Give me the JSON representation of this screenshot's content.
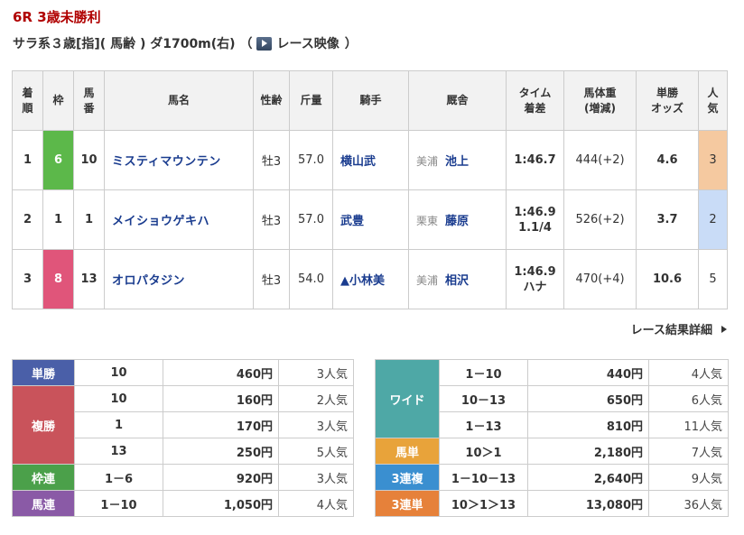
{
  "header": {
    "race_title": "6R 3歳未勝利",
    "race_info": "サラ系３歳[指]( 馬齢 ) ダ1700m(右) （",
    "video_link": "レース映像",
    "race_info_close": "）"
  },
  "results_table": {
    "headers": [
      [
        "着",
        "順"
      ],
      [
        "枠"
      ],
      [
        "馬",
        "番"
      ],
      [
        "馬名"
      ],
      [
        "性齢"
      ],
      [
        "斤量"
      ],
      [
        "騎手"
      ],
      [
        "厩舎"
      ],
      [
        "タイム",
        "着差"
      ],
      [
        "馬体重",
        "(増減)"
      ],
      [
        "単勝",
        "オッズ"
      ],
      [
        "人",
        "気"
      ]
    ],
    "rows": [
      {
        "rank": "1",
        "frame": "6",
        "frame_color": "#5cb84a",
        "number": "10",
        "horse": "ミスティマウンテン",
        "sex_age": "牡3",
        "weight": "57.0",
        "jockey": "横山武",
        "trainer_area": "美浦",
        "trainer": "池上",
        "time": "1:46.7",
        "margin": "",
        "body_weight": "444(+2)",
        "odds": "4.6",
        "popularity": "3",
        "pop_color": "#f5c9a0"
      },
      {
        "rank": "2",
        "frame": "1",
        "frame_color": "#ffffff",
        "number": "1",
        "horse": "メイショウゲキハ",
        "sex_age": "牡3",
        "weight": "57.0",
        "jockey": "武豊",
        "trainer_area": "栗東",
        "trainer": "藤原",
        "time": "1:46.9",
        "margin": "1.1/4",
        "body_weight": "526(+2)",
        "odds": "3.7",
        "popularity": "2",
        "pop_color": "#c9dcf7"
      },
      {
        "rank": "3",
        "frame": "8",
        "frame_color": "#e0557a",
        "number": "13",
        "horse": "オロパタジン",
        "sex_age": "牡3",
        "weight": "54.0",
        "jockey": "▲小林美",
        "trainer_area": "美浦",
        "trainer": "相沢",
        "time": "1:46.9",
        "margin": "ハナ",
        "body_weight": "470(+4)",
        "odds": "10.6",
        "popularity": "5",
        "pop_color": "#ffffff"
      }
    ]
  },
  "detail_link": "レース結果詳細",
  "payouts_left": [
    {
      "label": "単勝",
      "color": "#4a5fa8",
      "entries": [
        {
          "combo": "10",
          "amount": "460円",
          "pop": "3人気"
        }
      ]
    },
    {
      "label": "複勝",
      "color": "#c9535b",
      "entries": [
        {
          "combo": "10",
          "amount": "160円",
          "pop": "2人気"
        },
        {
          "combo": "1",
          "amount": "170円",
          "pop": "3人気"
        },
        {
          "combo": "13",
          "amount": "250円",
          "pop": "5人気"
        }
      ]
    },
    {
      "label": "枠連",
      "color": "#4ba04a",
      "entries": [
        {
          "combo": "1－6",
          "amount": "920円",
          "pop": "3人気"
        }
      ]
    },
    {
      "label": "馬連",
      "color": "#8a5aa6",
      "entries": [
        {
          "combo": "1－10",
          "amount": "1,050円",
          "pop": "4人気"
        }
      ]
    }
  ],
  "payouts_right": [
    {
      "label": "ワイド",
      "color": "#4ea8a6",
      "entries": [
        {
          "combo": "1－10",
          "amount": "440円",
          "pop": "4人気"
        },
        {
          "combo": "10－13",
          "amount": "650円",
          "pop": "6人気"
        },
        {
          "combo": "1－13",
          "amount": "810円",
          "pop": "11人気"
        }
      ]
    },
    {
      "label": "馬単",
      "color": "#e8a33a",
      "entries": [
        {
          "combo": "10＞1",
          "amount": "2,180円",
          "pop": "7人気"
        }
      ]
    },
    {
      "label": "3連複",
      "color": "#3a8fd0",
      "entries": [
        {
          "combo": "1－10－13",
          "amount": "2,640円",
          "pop": "9人気"
        }
      ]
    },
    {
      "label": "3連単",
      "color": "#e6813a",
      "entries": [
        {
          "combo": "10＞1＞13",
          "amount": "13,080円",
          "pop": "36人気"
        }
      ]
    }
  ]
}
